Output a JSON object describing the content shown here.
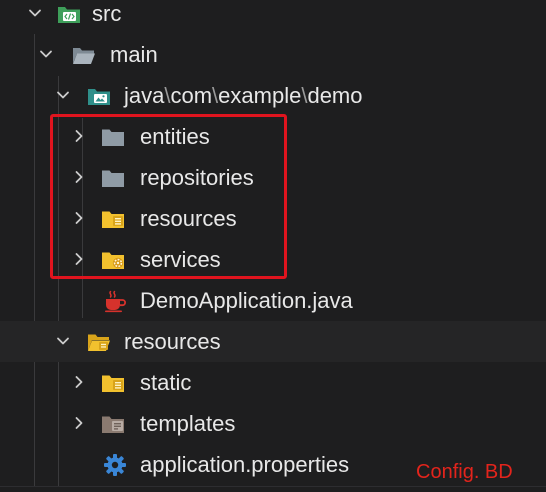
{
  "tree": {
    "src": "src",
    "main": "main",
    "java_package": {
      "part1": "java",
      "sep1": "\\",
      "part2": "com",
      "sep2": "\\",
      "part3": "example",
      "sep3": "\\",
      "part4": "demo"
    },
    "entities": "entities",
    "repositories": "repositories",
    "resources_pkg": "resources",
    "services": "services",
    "demo_application": "DemoApplication.java",
    "resources_folder": "resources",
    "static": "static",
    "templates": "templates",
    "application_properties": "application.properties"
  },
  "annotation": {
    "text": "Config. BD",
    "color": "#e3241c"
  },
  "colors": {
    "background": "#1e1e1f",
    "highlight_border": "#e0141e",
    "folder_gray": "#8f9ba5",
    "folder_yellow": "#f2c12e",
    "folder_green": "#3e9f5a",
    "java_red": "#d6322c",
    "gear_blue": "#3a86d6"
  },
  "icons": {
    "src": "source-folder-icon",
    "main": "folder-open-icon",
    "java": "java-package-icon",
    "entities": "folder-icon",
    "repositories": "folder-icon",
    "resources": "resources-folder-icon",
    "services": "services-folder-icon",
    "demo": "java-file-icon",
    "resources_folder": "resources-folder-open-icon",
    "static": "static-folder-icon",
    "templates": "templates-folder-icon",
    "properties": "gear-icon"
  }
}
